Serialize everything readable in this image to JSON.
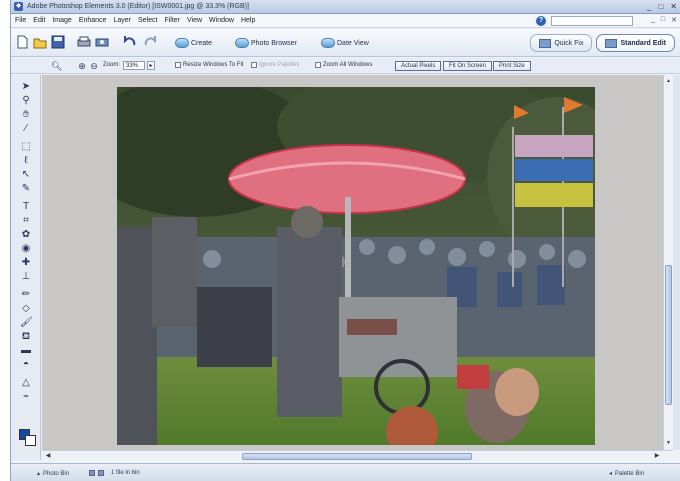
{
  "window": {
    "title": "Adobe Photoshop Elements 3.0 (Editor) [ISW0001.jpg @ 33.3% (RGB)]",
    "controls": [
      "_",
      "□",
      "✕"
    ]
  },
  "menu": {
    "items": [
      "File",
      "Edit",
      "Image",
      "Enhance",
      "Layer",
      "Select",
      "Filter",
      "View",
      "Window",
      "Help"
    ],
    "doc_controls": [
      "_",
      "□",
      "✕"
    ]
  },
  "shortcuts": {
    "create_label": "Create",
    "photo_browser_label": "Photo Browser",
    "date_view_label": "Date View",
    "quick_fix_label": "Quick Fix",
    "standard_edit_label": "Standard Edit"
  },
  "options": {
    "zoom_label": "Zoom:",
    "zoom_value": "33%",
    "resize_windows": "Resize Windows To Fit",
    "ignore_palettes": "Ignore Palettes",
    "zoom_all": "Zoom All Windows",
    "actual_pixels": "Actual Pixels",
    "fit_on_screen": "Fit On Screen",
    "print_size": "Print Size"
  },
  "status": {
    "photo_bin": "Photo Bin",
    "file_count": "1 file in bin",
    "palette_bin": "Palette Bin"
  },
  "colors": {
    "foreground": "#1747a6",
    "background": "#ffffff"
  }
}
